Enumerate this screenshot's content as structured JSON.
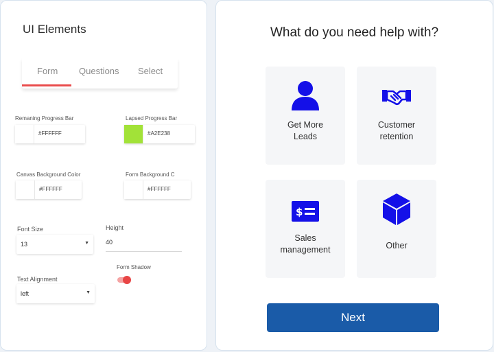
{
  "settings_panel": {
    "title": "UI Elements",
    "tabs": [
      {
        "label": "Form",
        "active": true
      },
      {
        "label": "Questions"
      },
      {
        "label": "Select"
      }
    ],
    "remaining_progress_bar": {
      "label": "Remaning Progress Bar",
      "hex": "#FFFFFF",
      "color": "#FFFFFF"
    },
    "lapsed_progress_bar": {
      "label": "Lapsed Progress Bar",
      "hex": "#A2E238",
      "color": "#A2E238"
    },
    "canvas_background_color": {
      "label": "Canvas Background Color",
      "hex": "#FFFFFF",
      "color": "#FFFFFF"
    },
    "form_background_color": {
      "label": "Form Background C",
      "hex": "#FFFFFF",
      "color": "#FFFFFF"
    },
    "font_size": {
      "label": "Font Size",
      "value": "13"
    },
    "height": {
      "label": "Height",
      "value": "40"
    },
    "form_shadow": {
      "label": "Form Shadow",
      "enabled": true
    },
    "text_alignment": {
      "label": "Text Alignment",
      "value": "left"
    },
    "accent_color": "#E94C4C"
  },
  "preview": {
    "question": "What do you need help with?",
    "options": [
      {
        "line1": "Get More",
        "line2": "Leads",
        "icon": "person-icon"
      },
      {
        "line1": "Customer",
        "line2": "retention",
        "icon": "handshake-icon"
      },
      {
        "line1": "Sales",
        "line2": "management",
        "icon": "dollar-card-icon"
      },
      {
        "line1": "Other",
        "line2": "",
        "icon": "cube-icon"
      }
    ],
    "next_label": "Next",
    "icon_color": "#1410E8",
    "button_color": "#1A5BA8"
  }
}
